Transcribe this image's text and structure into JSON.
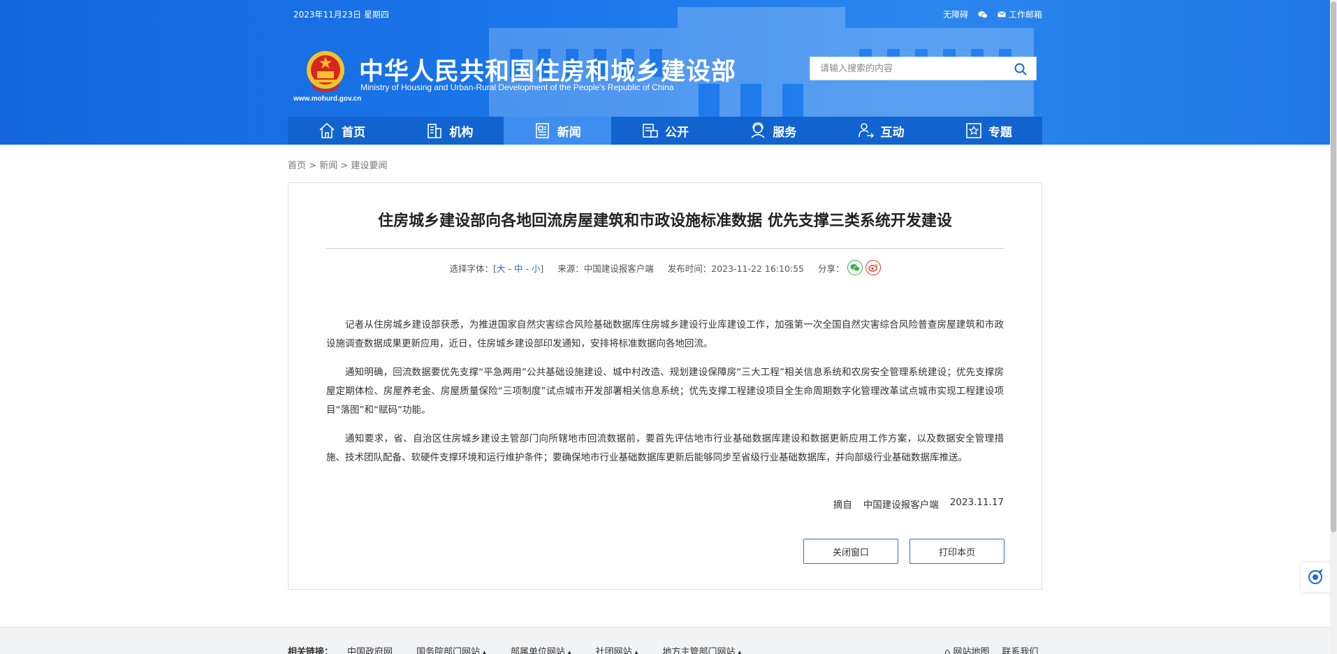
{
  "header": {
    "date": "2023年11月23日 星期四",
    "accessibility": "无障碍",
    "mail": "工作邮箱",
    "site_url": "www.mohurd.gov.cn",
    "title_cn": "中华人民共和国住房和城乡建设部",
    "title_en": "Ministry of Housing and Urban-Rural Development of the People's Republic of China",
    "search_placeholder": "请输入搜索的内容"
  },
  "nav": [
    {
      "label": "首页",
      "icon": "home-icon"
    },
    {
      "label": "机构",
      "icon": "building-icon"
    },
    {
      "label": "新闻",
      "icon": "news-icon",
      "active": true
    },
    {
      "label": "公开",
      "icon": "disclosure-icon"
    },
    {
      "label": "服务",
      "icon": "service-icon"
    },
    {
      "label": "互动",
      "icon": "interaction-icon"
    },
    {
      "label": "专题",
      "icon": "topic-icon"
    }
  ],
  "breadcrumb": {
    "home": "首页",
    "sep": " > ",
    "news": "新闻",
    "current": "建设要闻"
  },
  "article": {
    "title": "住房城乡建设部向各地回流房屋建筑和市政设施标准数据 优先支撑三类系统开发建设",
    "font_select_label": "选择字体：[",
    "font_large": "大",
    "font_medium": "中",
    "font_small": "小",
    "font_close": "]",
    "dash": " - ",
    "source": "来源：中国建设报客户端",
    "publish_time": "发布时间：2023-11-22 16:10:55",
    "share_label": "分享：",
    "paragraphs": [
      "记者从住房城乡建设部获悉，为推进国家自然灾害综合风险基础数据库住房城乡建设行业库建设工作，加强第一次全国自然灾害综合风险普查房屋建筑和市政设施调查数据成果更新应用，近日，住房城乡建设部印发通知，安排将标准数据向各地回流。",
      "通知明确，回流数据要优先支撑“平急两用”公共基础设施建设、城中村改造、规划建设保障房“三大工程”相关信息系统和农房安全管理系统建设；优先支撑房屋定期体检、房屋养老金、房屋质量保险“三项制度”试点城市开发部署相关信息系统；优先支撑工程建设项目全生命周期数字化管理改革试点城市实现工程建设项目“落图”和“赋码”功能。",
      "通知要求，省、自治区住房城乡建设主管部门向所辖地市回流数据前，要首先评估地市行业基础数据库建设和数据更新应用工作方案，以及数据安全管理措施、技术团队配备、软硬件支撑环境和运行维护条件；要确保地市行业基础数据库更新后能够同步至省级行业基础数据库，并向部级行业基础数据库推送。"
    ],
    "excerpt_label": "摘自",
    "excerpt_source": "中国建设报客户端",
    "excerpt_date": "2023.11.17",
    "close_button": "关闭窗口",
    "print_button": "打印本页"
  },
  "footer": {
    "related_label": "相关链接：",
    "links": [
      "中国政府网",
      "国务院部门网站",
      "部属单位网站",
      "社团网站",
      "地方主管部门网站"
    ],
    "sitemap": "网站地图",
    "contact": "联系我们"
  },
  "colors": {
    "header_blue": "#1a76ea",
    "nav_blue": "#1163cf",
    "nav_active": "#3d8ef0",
    "link_blue": "#1a6ad6"
  }
}
